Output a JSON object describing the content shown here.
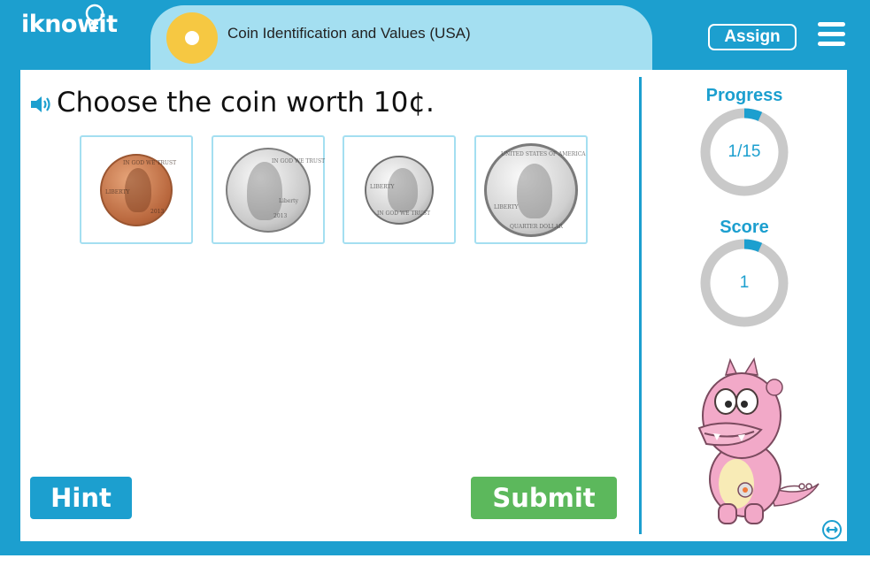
{
  "header": {
    "logo_text": "iknowit",
    "title": "Coin Identification and Values (USA)",
    "assign_label": "Assign"
  },
  "question": {
    "text": "Choose the coin worth 10¢."
  },
  "choices": [
    {
      "coin": "penny"
    },
    {
      "coin": "nickel"
    },
    {
      "coin": "dime"
    },
    {
      "coin": "quarter"
    }
  ],
  "buttons": {
    "hint_label": "Hint",
    "submit_label": "Submit"
  },
  "sidebar": {
    "progress_label": "Progress",
    "progress_value": "1/15",
    "progress_fraction": 0.0667,
    "score_label": "Score",
    "score_value": "1",
    "score_fraction": 0.0667
  },
  "colors": {
    "brand_blue": "#1c9fcf",
    "title_bg": "#a4dff1",
    "submit_green": "#5cb85c",
    "accent_yellow": "#f6c842"
  },
  "icons": [
    "speaker-icon",
    "menu-icon",
    "expand-icon",
    "lightbulb-icon"
  ]
}
